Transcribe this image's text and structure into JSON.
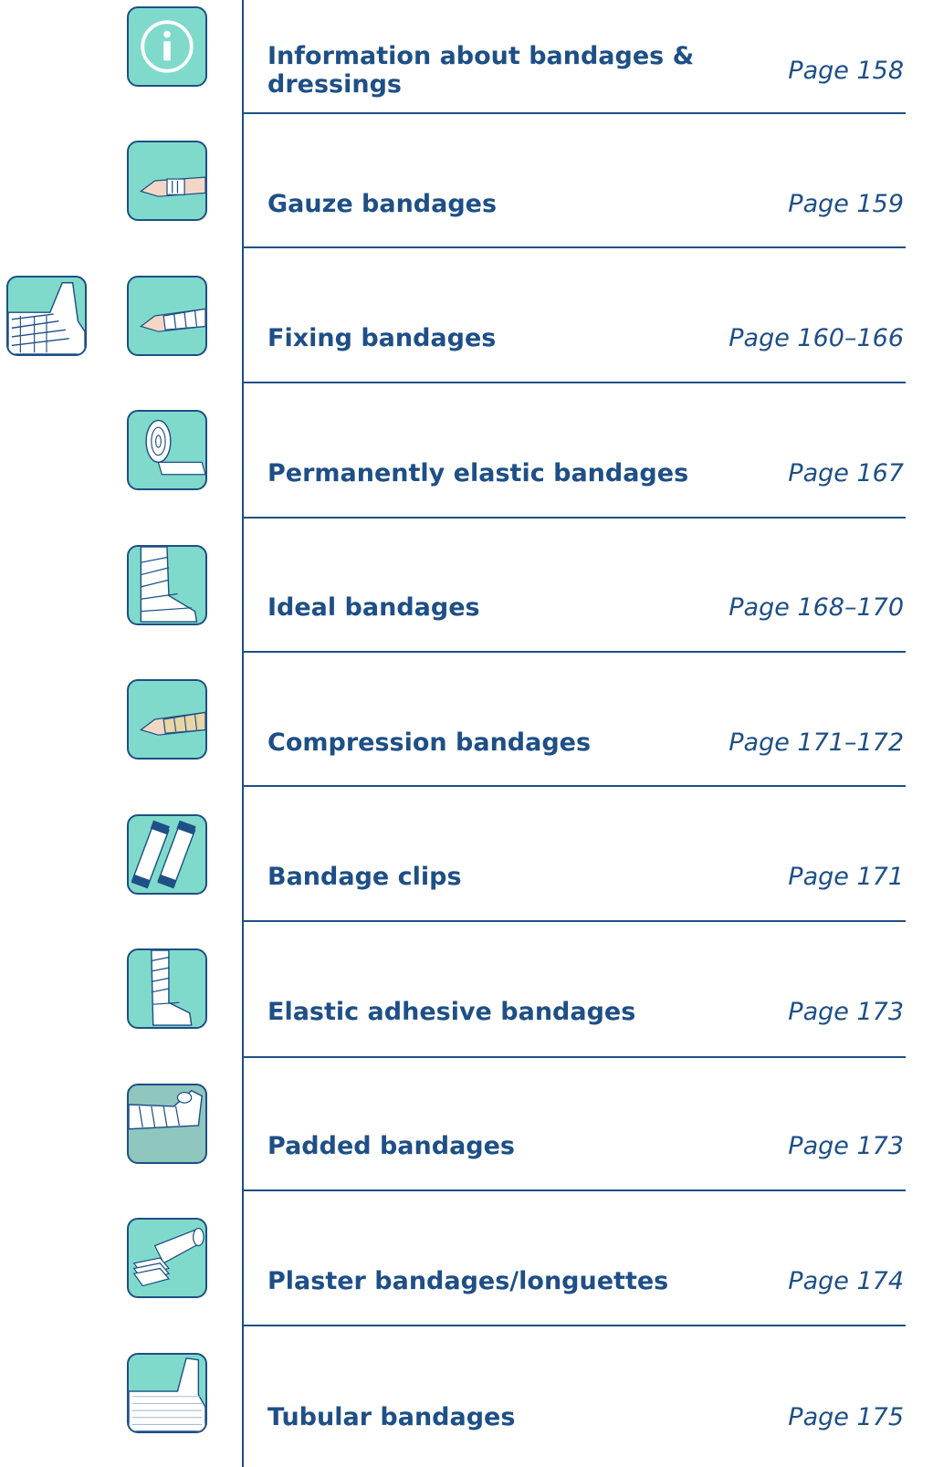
{
  "entries": [
    {
      "label": "Information about bandages & dressings",
      "page": "Page 158",
      "icon": "info-icon"
    },
    {
      "label": "Gauze bandages",
      "page": "Page 159",
      "icon": "gauze-bandage-icon"
    },
    {
      "label": "Fixing bandages",
      "page": "Page 160–166",
      "icon": "fixing-bandage-icon"
    },
    {
      "label": "Permanently elastic bandages",
      "page": "Page 167",
      "icon": "bandage-roll-icon"
    },
    {
      "label": "Ideal bandages",
      "page": "Page 168–170",
      "icon": "ideal-bandage-foot-icon"
    },
    {
      "label": "Compression bandages",
      "page": "Page 171–172",
      "icon": "compression-bandage-icon"
    },
    {
      "label": "Bandage clips",
      "page": "Page 171",
      "icon": "bandage-clips-icon"
    },
    {
      "label": "Elastic adhesive bandages",
      "page": "Page 173",
      "icon": "elastic-adhesive-leg-icon"
    },
    {
      "label": "Padded bandages",
      "page": "Page 173",
      "icon": "padded-bandage-icon"
    },
    {
      "label": "Plaster bandages/longuettes",
      "page": "Page 174",
      "icon": "plaster-bandage-icon"
    },
    {
      "label": "Tubular bandages",
      "page": "Page 175",
      "icon": "tubular-bandage-icon"
    }
  ],
  "section_icon": "bandaged-ankle-icon",
  "colors": {
    "accent": "#1e4f86",
    "icon_bg": "#7fdacb"
  }
}
